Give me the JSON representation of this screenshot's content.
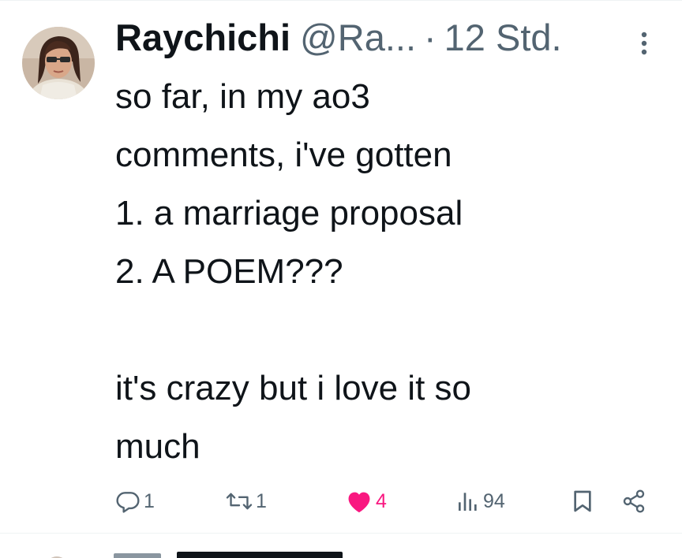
{
  "tweet": {
    "author": {
      "display_name": "Raychichi",
      "handle": "@Ra...",
      "avatar_icon": "profile-photo"
    },
    "separator": "·",
    "timestamp": "12 Std.",
    "more_icon": "more-vertical-icon",
    "text_lines": [
      "so far, in my ao3",
      "comments, i've gotten",
      "1. a marriage proposal",
      "2. A POEM???",
      "",
      "it's crazy but i love it so",
      "much"
    ],
    "actions": {
      "replies": "1",
      "reposts": "1",
      "likes": "4",
      "views": "94",
      "liked": true
    }
  },
  "colors": {
    "text": "#0f1419",
    "secondary": "#536471",
    "like": "#f91880",
    "divider": "#eff3f4"
  }
}
